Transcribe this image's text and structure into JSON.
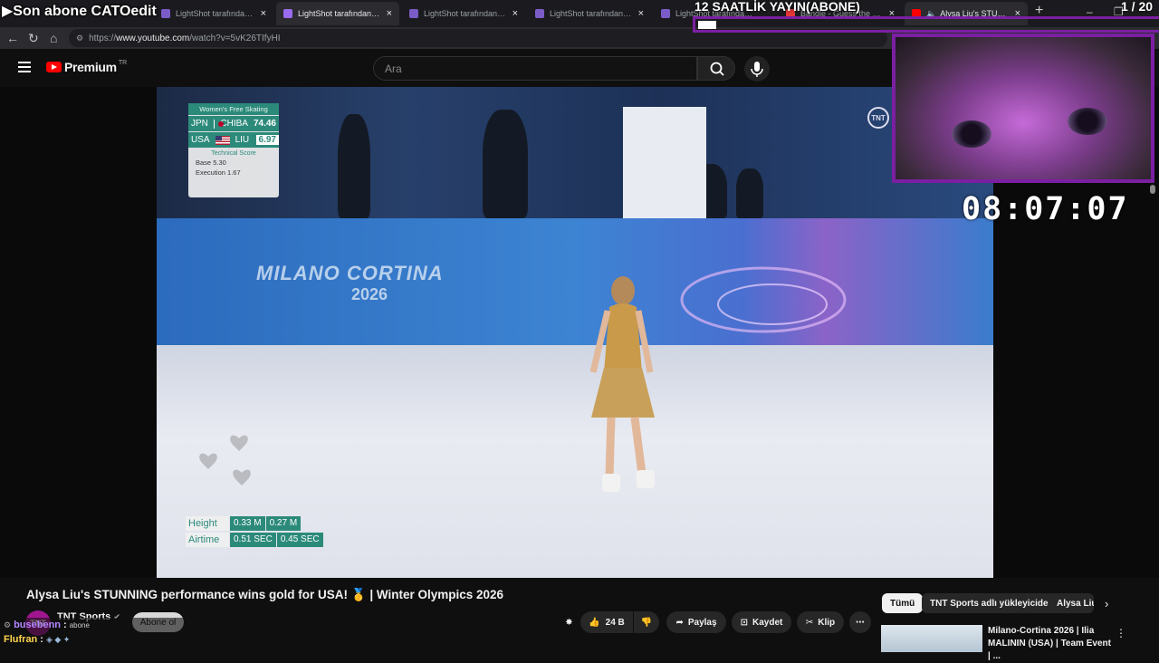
{
  "overlay": {
    "top_left_text": "▶Son abone CATOedit",
    "stream_title": "12 SAATLİK YAYIN(ABONE)",
    "counter": "1 / 20",
    "timer": "08:07:07"
  },
  "tabs": [
    {
      "label": "LightShot tarafından Ekran G",
      "active": false
    },
    {
      "label": "LightShot tarafından Ekran G",
      "active": true
    },
    {
      "label": "LightShot tarafından Ekran G",
      "active": false
    },
    {
      "label": "LightShot tarafından Ekran G",
      "active": false
    },
    {
      "label": "LightShot tarafından Ekran G",
      "active": false
    },
    {
      "label": "Bandle - Guess the song, on",
      "active": false
    },
    {
      "label": "Alysa Liu's STUNNING pe",
      "active": true
    }
  ],
  "address_bar": {
    "url_prefix": "https://",
    "url_host": "www.youtube.com",
    "url_path": "/watch?v=5vK26TIfyHI"
  },
  "youtube": {
    "logo_text": "Premium",
    "region": "TR",
    "search_placeholder": "Ara"
  },
  "video_overlay": {
    "score_header": "Women's Free Skating",
    "rows": [
      {
        "country": "JPN",
        "name": "CHIBA",
        "score": "74.46"
      },
      {
        "country": "USA",
        "name": "LIU",
        "score": "6.97"
      }
    ],
    "tech_label": "Technical Score",
    "base_label": "Base",
    "base_value": "5.30",
    "exec_label": "Execution",
    "exec_value": "1.67",
    "height_label": "Height",
    "height_values": [
      "0.33 M",
      "0.27 M"
    ],
    "airtime_label": "Airtime",
    "airtime_values": [
      "0.51 SEC",
      "0.45 SEC"
    ],
    "tnt_bug": "TNT",
    "board_logo": "MILANO CORTINA",
    "board_year": "2026"
  },
  "video": {
    "title": "Alysa Liu's STUNNING performance wins gold for USA! 🥇 | Winter Olympics 2026",
    "channel": "TNT Sports",
    "channel_avatar": "TNT",
    "subscribe": "Abone ol",
    "likes": "24 B",
    "share": "Paylaş",
    "save": "Kaydet",
    "clip": "Klip"
  },
  "chips": [
    "Tümü",
    "TNT Sports adlı yükleyiciden",
    "Alysa Liu"
  ],
  "recommendation": {
    "title": "Milano-Cortina 2026 | Ilia MALININ (USA) | Team Event | ..."
  },
  "chat": [
    {
      "user": "busebenn",
      "message": "abone",
      "user_color": "#b388ff"
    },
    {
      "user": "Flufran",
      "message": "",
      "user_color": "#ffd54f"
    }
  ]
}
